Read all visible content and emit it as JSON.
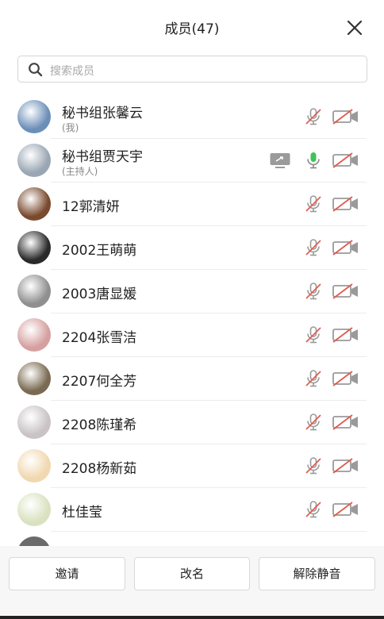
{
  "header": {
    "title": "成员(47)",
    "close_icon": "close-icon"
  },
  "search": {
    "placeholder": "搜索成员",
    "icon": "search-icon"
  },
  "members": [
    {
      "name": "秘书组张馨云",
      "sub": "(我)",
      "mic": "muted",
      "cam": "off",
      "avatar_color": "#6c8fb8"
    },
    {
      "name": "秘书组贾天宇",
      "sub": "(主持人)",
      "mic": "on",
      "cam": "off",
      "sharing": true,
      "avatar_color": "#9aa6b3"
    },
    {
      "name": "12郭清妍",
      "sub": "",
      "mic": "muted",
      "cam": "off",
      "avatar_color": "#7a4a2e"
    },
    {
      "name": "2002王萌萌",
      "sub": "",
      "mic": "muted",
      "cam": "off",
      "avatar_color": "#2a2a2a"
    },
    {
      "name": "2003唐显媛",
      "sub": "",
      "mic": "muted",
      "cam": "off",
      "avatar_color": "#8f8f8f"
    },
    {
      "name": "2204张雪洁",
      "sub": "",
      "mic": "muted",
      "cam": "off",
      "avatar_color": "#d6a0a0"
    },
    {
      "name": "2207何全芳",
      "sub": "",
      "mic": "muted",
      "cam": "off",
      "avatar_color": "#7a6a52"
    },
    {
      "name": "2208陈瑾希",
      "sub": "",
      "mic": "muted",
      "cam": "off",
      "avatar_color": "#c9c3c6"
    },
    {
      "name": "2208杨新茹",
      "sub": "",
      "mic": "muted",
      "cam": "off",
      "avatar_color": "#f1d8b0"
    },
    {
      "name": "杜佳莹",
      "sub": "",
      "mic": "muted",
      "cam": "off",
      "avatar_color": "#d9e2c0"
    }
  ],
  "footer": {
    "invite_label": "邀请",
    "rename_label": "改名",
    "unmute_label": "解除静音"
  },
  "colors": {
    "muted_red": "#e05a4f",
    "icon_gray": "#9a9a9a",
    "mic_on_green": "#3cc45a"
  }
}
